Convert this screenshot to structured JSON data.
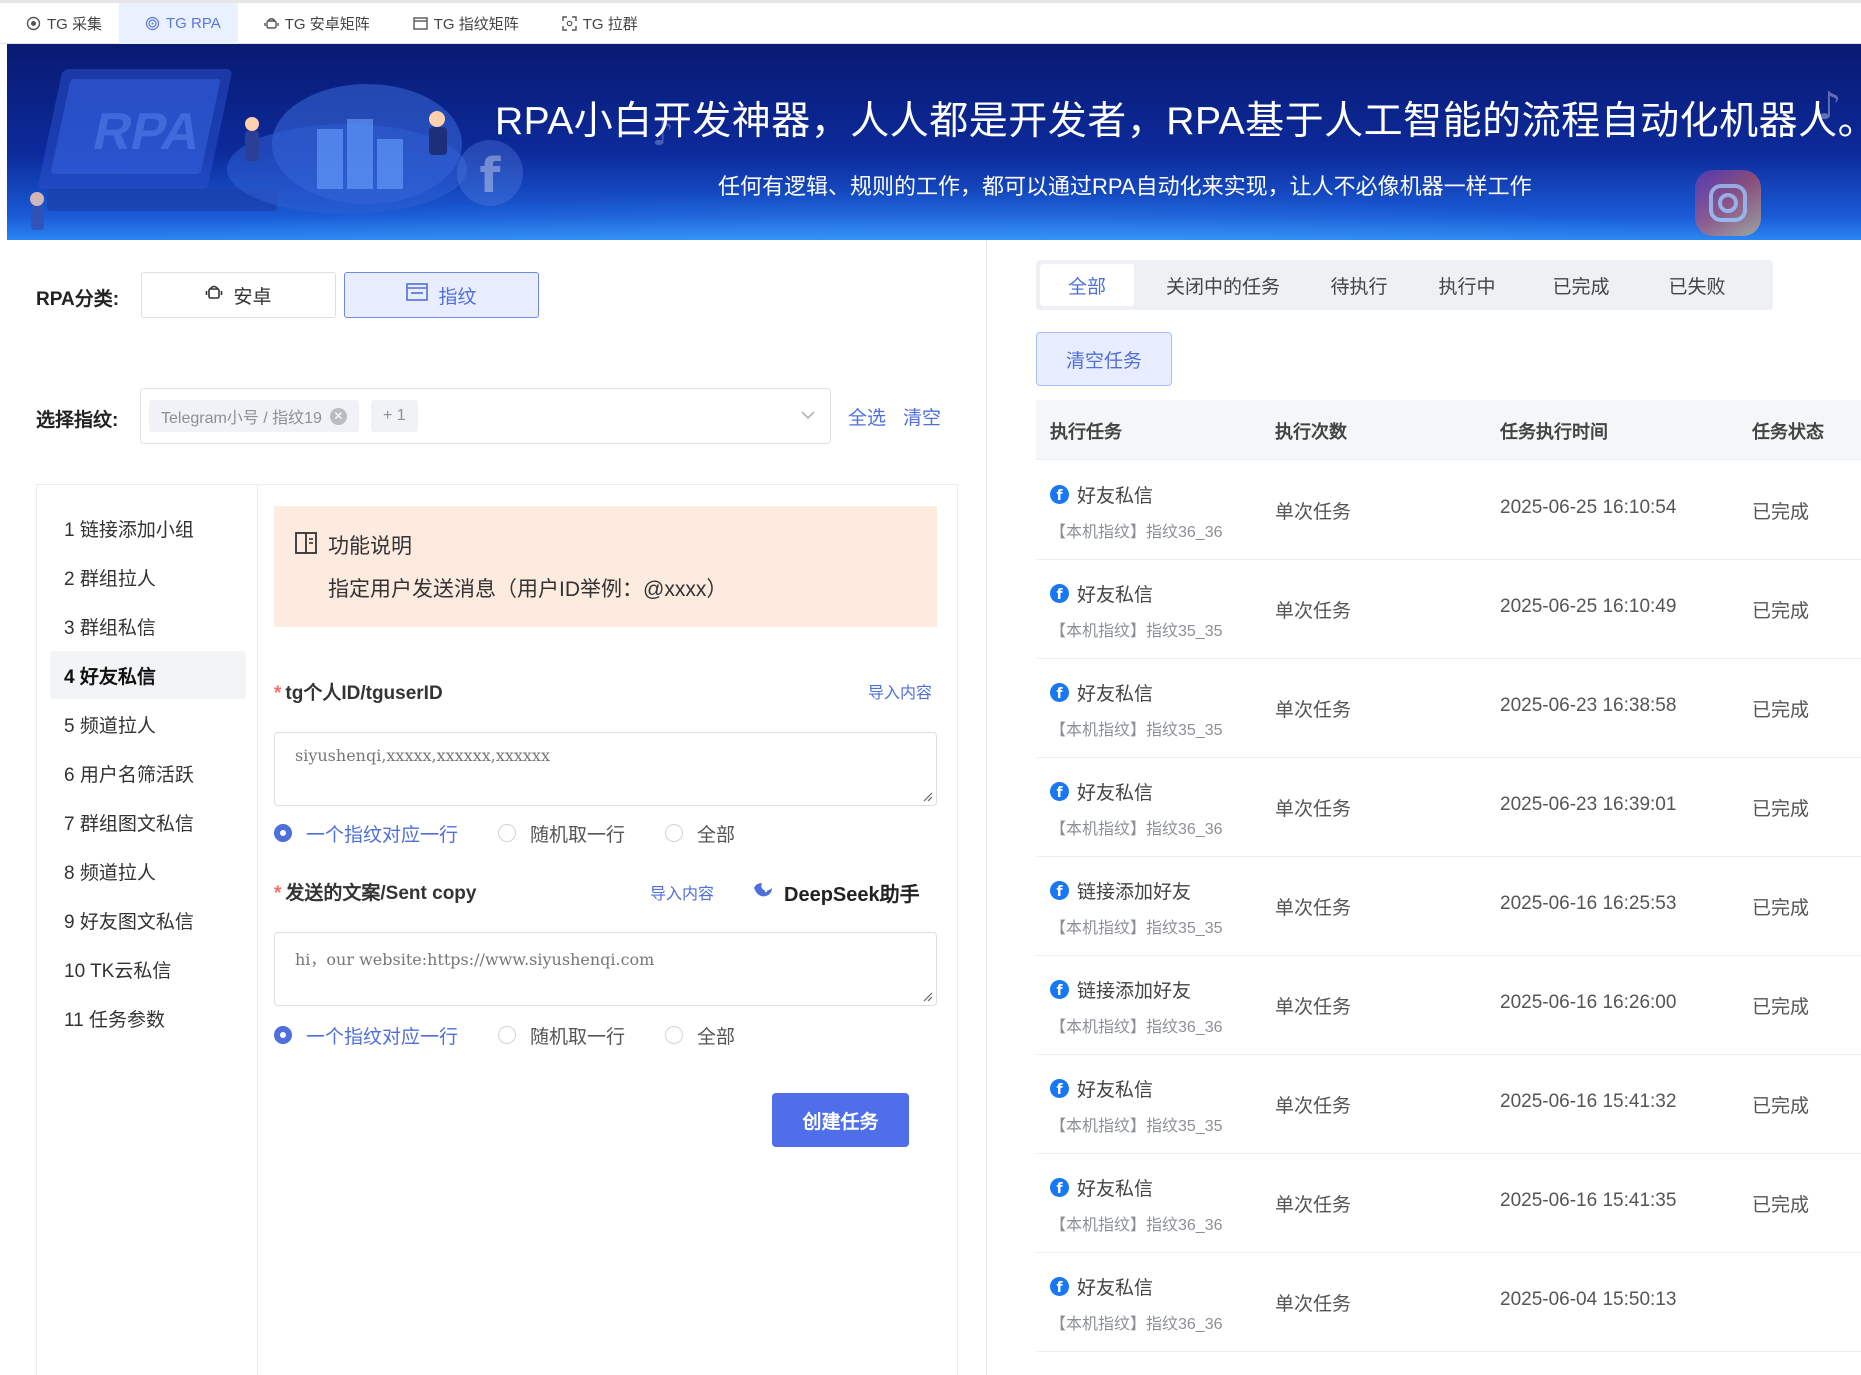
{
  "top_tabs": [
    {
      "label": "TG 采集",
      "icon": "camera-icon",
      "active": false
    },
    {
      "label": "TG RPA",
      "icon": "fingerprint-icon",
      "active": true
    },
    {
      "label": "TG 安卓矩阵",
      "icon": "android-icon",
      "active": false
    },
    {
      "label": "TG 指纹矩阵",
      "icon": "window-icon",
      "active": false
    },
    {
      "label": "TG 拉群",
      "icon": "scan-icon",
      "active": false
    }
  ],
  "banner": {
    "title": "RPA小白开发神器，人人都是开发者，RPA基于人工智能的流程自动化机器人。",
    "subtitle": "任何有逻辑、规则的工作，都可以通过RPA自动化来实现，让人不必像机器一样工作",
    "art_text": "RPA"
  },
  "form": {
    "category_label": "RPA分类:",
    "categories": [
      {
        "label": "安卓",
        "icon": "android-icon",
        "active": false
      },
      {
        "label": "指纹",
        "icon": "window-icon",
        "active": true
      }
    ],
    "fingerprint_label": "选择指纹:",
    "selected_tag": "Telegram小号 / 指纹19",
    "more_tag": "+ 1",
    "select_all": "全选",
    "clear": "清空"
  },
  "menu": [
    "1 链接添加小组",
    "2 群组拉人",
    "3 群组私信",
    "4 好友私信",
    "5 频道拉人",
    "6 用户名筛活跃",
    "7 群组图文私信",
    "8 频道拉人",
    "9 好友图文私信",
    "10 TK云私信",
    "11 任务参数"
  ],
  "menu_active_index": 3,
  "info": {
    "title": "功能说明",
    "desc": "指定用户发送消息（用户ID举例：@xxxx）"
  },
  "field_userid": {
    "label": "tg个人ID/tguserID",
    "import": "导入内容",
    "value": "siyushenqi,xxxxx,xxxxxx,xxxxxx"
  },
  "field_copy": {
    "label": "发送的文案/Sent copy",
    "import": "导入内容",
    "assistant": "DeepSeek助手",
    "value": "hi，our website:https://www.siyushenqi.com"
  },
  "radio_options": [
    "一个指纹对应一行",
    "随机取一行",
    "全部"
  ],
  "radio_selected": 0,
  "create_button": "创建任务",
  "status_tabs": [
    "全部",
    "关闭中的任务",
    "待执行",
    "执行中",
    "已完成",
    "已失败"
  ],
  "status_active": 0,
  "clear_tasks": "清空任务",
  "table": {
    "headers": [
      "执行任务",
      "执行次数",
      "任务执行时间",
      "任务状态"
    ],
    "rows": [
      {
        "task": "好友私信",
        "device": "【本机指纹】指纹36_36",
        "count": "单次任务",
        "time": "2025-06-25 16:10:54",
        "status": "已完成"
      },
      {
        "task": "好友私信",
        "device": "【本机指纹】指纹35_35",
        "count": "单次任务",
        "time": "2025-06-25 16:10:49",
        "status": "已完成"
      },
      {
        "task": "好友私信",
        "device": "【本机指纹】指纹35_35",
        "count": "单次任务",
        "time": "2025-06-23 16:38:58",
        "status": "已完成"
      },
      {
        "task": "好友私信",
        "device": "【本机指纹】指纹36_36",
        "count": "单次任务",
        "time": "2025-06-23 16:39:01",
        "status": "已完成"
      },
      {
        "task": "链接添加好友",
        "device": "【本机指纹】指纹35_35",
        "count": "单次任务",
        "time": "2025-06-16 16:25:53",
        "status": "已完成"
      },
      {
        "task": "链接添加好友",
        "device": "【本机指纹】指纹36_36",
        "count": "单次任务",
        "time": "2025-06-16 16:26:00",
        "status": "已完成"
      },
      {
        "task": "好友私信",
        "device": "【本机指纹】指纹35_35",
        "count": "单次任务",
        "time": "2025-06-16 15:41:32",
        "status": "已完成"
      },
      {
        "task": "好友私信",
        "device": "【本机指纹】指纹36_36",
        "count": "单次任务",
        "time": "2025-06-16 15:41:35",
        "status": "已完成"
      },
      {
        "task": "好友私信",
        "device": "【本机指纹】指纹36_36",
        "count": "单次任务",
        "time": "2025-06-04 15:50:13",
        "status": ""
      }
    ]
  },
  "colors": {
    "accent": "#4f6fdc",
    "button": "#4f6fea",
    "info_bg": "#fdebe0",
    "banner_top": "#081a72",
    "banner_bottom": "#2a86f2",
    "facebook": "#1877f2"
  }
}
